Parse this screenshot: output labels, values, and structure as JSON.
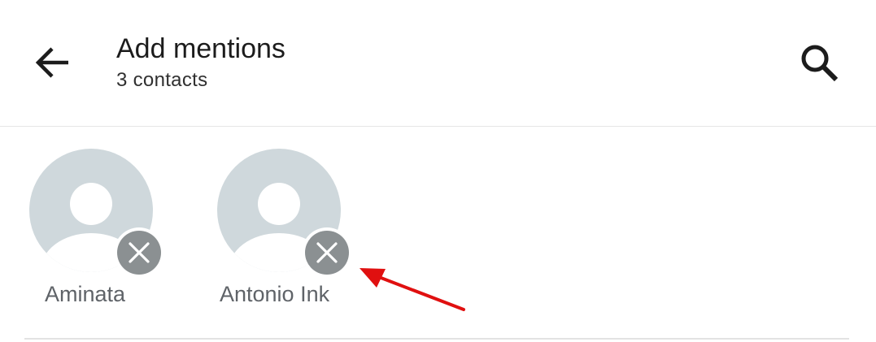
{
  "header": {
    "title": "Add mentions",
    "subtitle": "3 contacts",
    "back_icon": "arrow-left-icon",
    "search_icon": "search-icon"
  },
  "selected_contacts": [
    {
      "name": "Aminata",
      "avatar_icon": "default-avatar-icon",
      "remove_icon": "close-icon"
    },
    {
      "name": "Antonio Ink",
      "avatar_icon": "default-avatar-icon",
      "remove_icon": "close-icon"
    }
  ],
  "colors": {
    "avatar_bg": "#cfd8dc",
    "avatar_fg": "#ffffff",
    "remove_bg": "#8b9092",
    "annotation": "#e01010"
  }
}
